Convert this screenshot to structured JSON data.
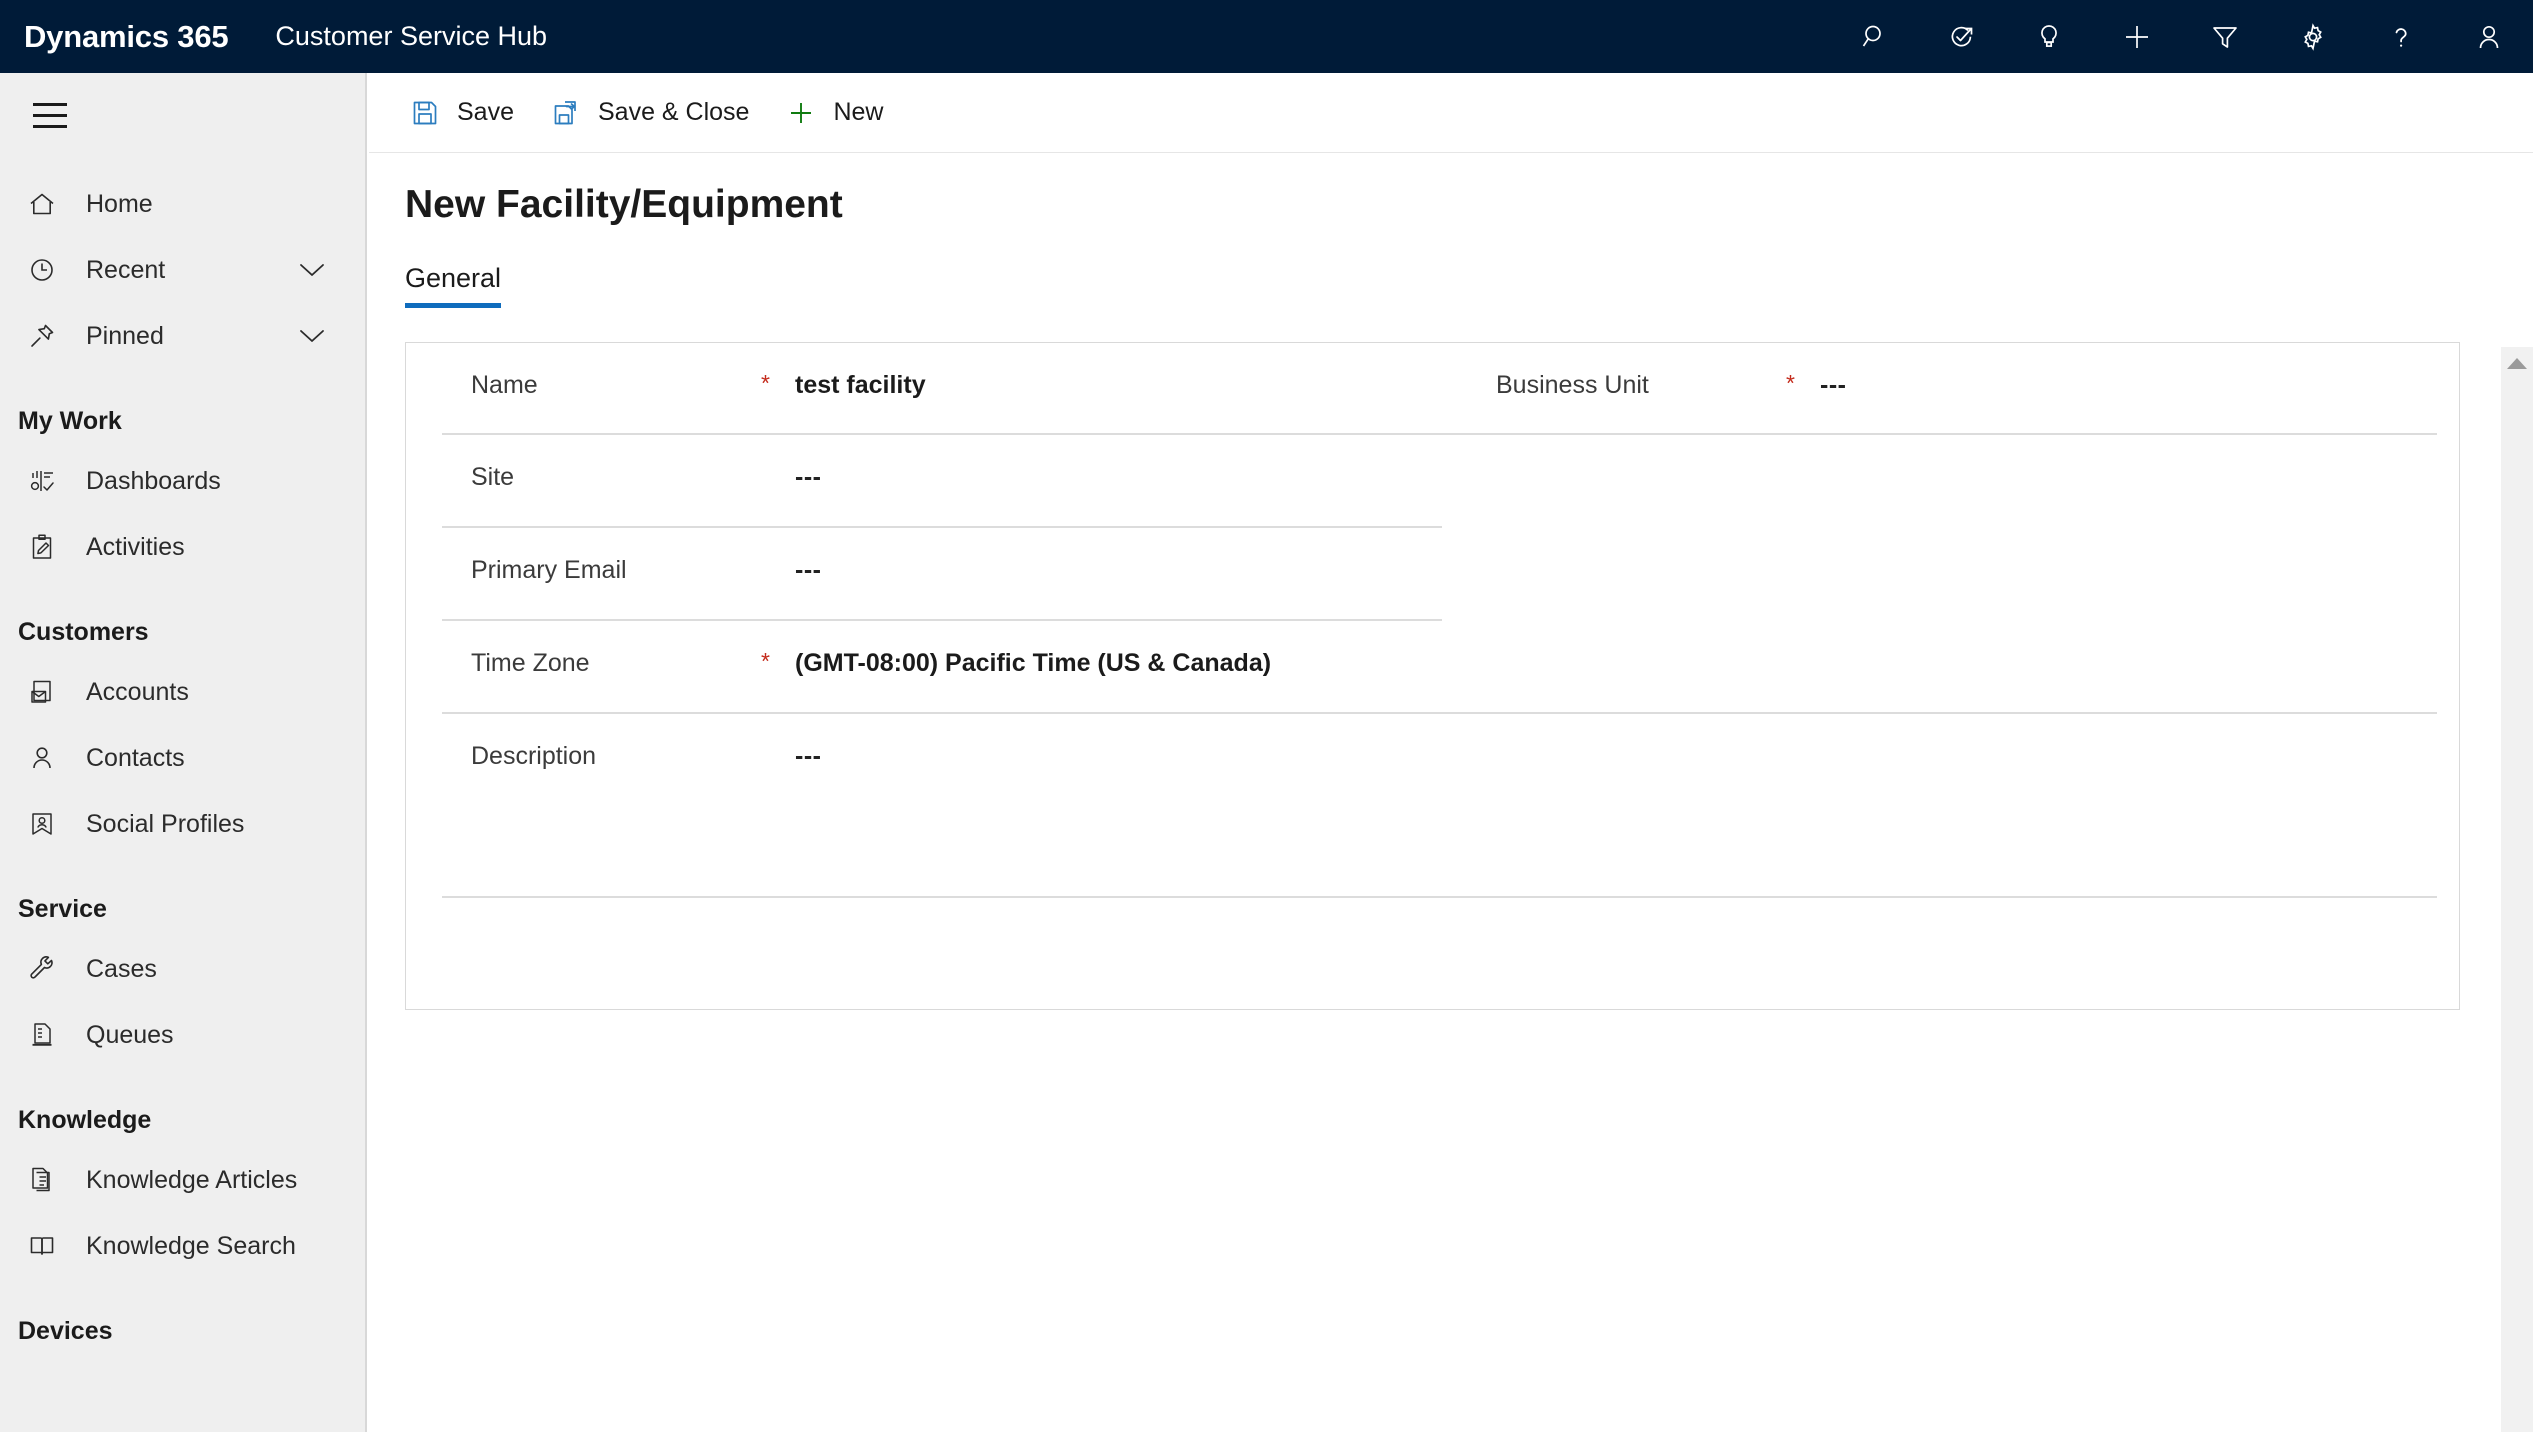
{
  "header": {
    "brand": "Dynamics 365",
    "app_name": "Customer Service Hub",
    "icons": [
      {
        "name": "search-icon",
        "label": "Search"
      },
      {
        "name": "diagnostics-icon",
        "label": "Diagnostics"
      },
      {
        "name": "lightbulb-icon",
        "label": "Assistant"
      },
      {
        "name": "plus-icon",
        "label": "Quick Create"
      },
      {
        "name": "filter-icon",
        "label": "Filter"
      },
      {
        "name": "gear-icon",
        "label": "Settings"
      },
      {
        "name": "help-icon",
        "label": "Help"
      },
      {
        "name": "user-icon",
        "label": "Account Manager"
      }
    ]
  },
  "sidebar": {
    "menu_button": "Site Map",
    "top_items": [
      {
        "label": "Home",
        "icon": "home-icon",
        "chevron": false
      },
      {
        "label": "Recent",
        "icon": "clock-icon",
        "chevron": true
      },
      {
        "label": "Pinned",
        "icon": "pin-icon",
        "chevron": true
      }
    ],
    "groups": [
      {
        "title": "My Work",
        "items": [
          {
            "label": "Dashboards",
            "icon": "dashboard-icon"
          },
          {
            "label": "Activities",
            "icon": "activities-icon"
          }
        ]
      },
      {
        "title": "Customers",
        "items": [
          {
            "label": "Accounts",
            "icon": "accounts-icon"
          },
          {
            "label": "Contacts",
            "icon": "contact-icon"
          },
          {
            "label": "Social Profiles",
            "icon": "social-profile-icon"
          }
        ]
      },
      {
        "title": "Service",
        "items": [
          {
            "label": "Cases",
            "icon": "wrench-icon"
          },
          {
            "label": "Queues",
            "icon": "queue-icon"
          }
        ]
      },
      {
        "title": "Knowledge",
        "items": [
          {
            "label": "Knowledge Articles",
            "icon": "article-icon"
          },
          {
            "label": "Knowledge Search",
            "icon": "book-icon"
          }
        ]
      },
      {
        "title": "Devices",
        "items": []
      }
    ]
  },
  "command_bar": {
    "buttons": [
      {
        "label": "Save",
        "icon": "save-icon"
      },
      {
        "label": "Save & Close",
        "icon": "save-close-icon"
      },
      {
        "label": "New",
        "icon": "plus-icon"
      }
    ]
  },
  "form": {
    "title": "New Facility/Equipment",
    "tabs": [
      {
        "label": "General",
        "active": true
      }
    ],
    "fields": [
      {
        "label": "Name",
        "required": true,
        "value": "test facility",
        "filled": true,
        "column": "left",
        "divider": "full"
      },
      {
        "label": "Business Unit",
        "required": true,
        "value": "---",
        "filled": false,
        "column": "right",
        "divider": "none"
      },
      {
        "label": "Site",
        "required": false,
        "value": "---",
        "filled": false,
        "column": "left",
        "divider": "half"
      },
      {
        "label": "Primary Email",
        "required": false,
        "value": "---",
        "filled": false,
        "column": "left",
        "divider": "half"
      },
      {
        "label": "Time Zone",
        "required": true,
        "value": "(GMT-08:00) Pacific Time (US & Canada)",
        "filled": true,
        "column": "left",
        "divider": "full"
      },
      {
        "label": "Description",
        "required": false,
        "value": "---",
        "filled": false,
        "column": "left",
        "divider": "full"
      }
    ]
  },
  "colors": {
    "header_bg": "#001B38",
    "sidebar_bg": "#EFEFEF",
    "accent_blue": "#0F6CBD",
    "required_red": "#C42B1C",
    "new_green": "#107C10",
    "save_blue": "#2C7DBF"
  }
}
